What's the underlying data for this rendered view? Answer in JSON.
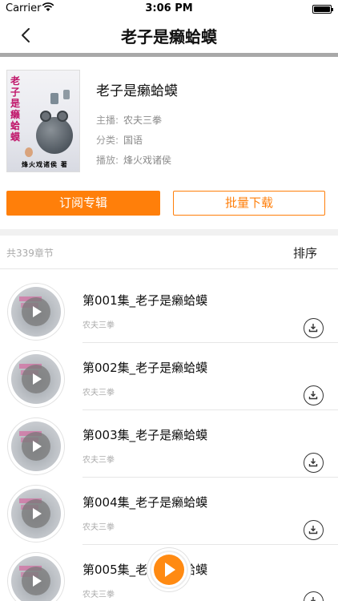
{
  "status_bar": {
    "carrier": "Carrier",
    "time": "3:06 PM"
  },
  "nav": {
    "title": "老子是癞蛤蟆",
    "back_icon": "chevron-left-icon"
  },
  "album": {
    "cover_title": "老子是癞蛤蟆",
    "cover_author": "烽火戏诸侯 著",
    "title": "老子是癞蛤蟆",
    "host_label": "主播:",
    "host": "农夫三拳",
    "category_label": "分类:",
    "category": "国语",
    "play_label": "播放:",
    "play": "烽火戏诸侯"
  },
  "actions": {
    "subscribe": "订阅专辑",
    "batch_download": "批量下载"
  },
  "list_header": {
    "count": "共339章节",
    "sort": "排序"
  },
  "episodes": [
    {
      "title": "第001集_老子是癞蛤蟆",
      "author": "农夫三拳"
    },
    {
      "title": "第002集_老子是癞蛤蟆",
      "author": "农夫三拳"
    },
    {
      "title": "第003集_老子是癞蛤蟆",
      "author": "农夫三拳"
    },
    {
      "title": "第004集_老子是癞蛤蟆",
      "author": "农夫三拳"
    },
    {
      "title": "第005集_老子是癞蛤蟆",
      "author": "农夫三拳"
    }
  ],
  "colors": {
    "accent": "#ff7f0a",
    "divider": "#a8a8a8"
  }
}
